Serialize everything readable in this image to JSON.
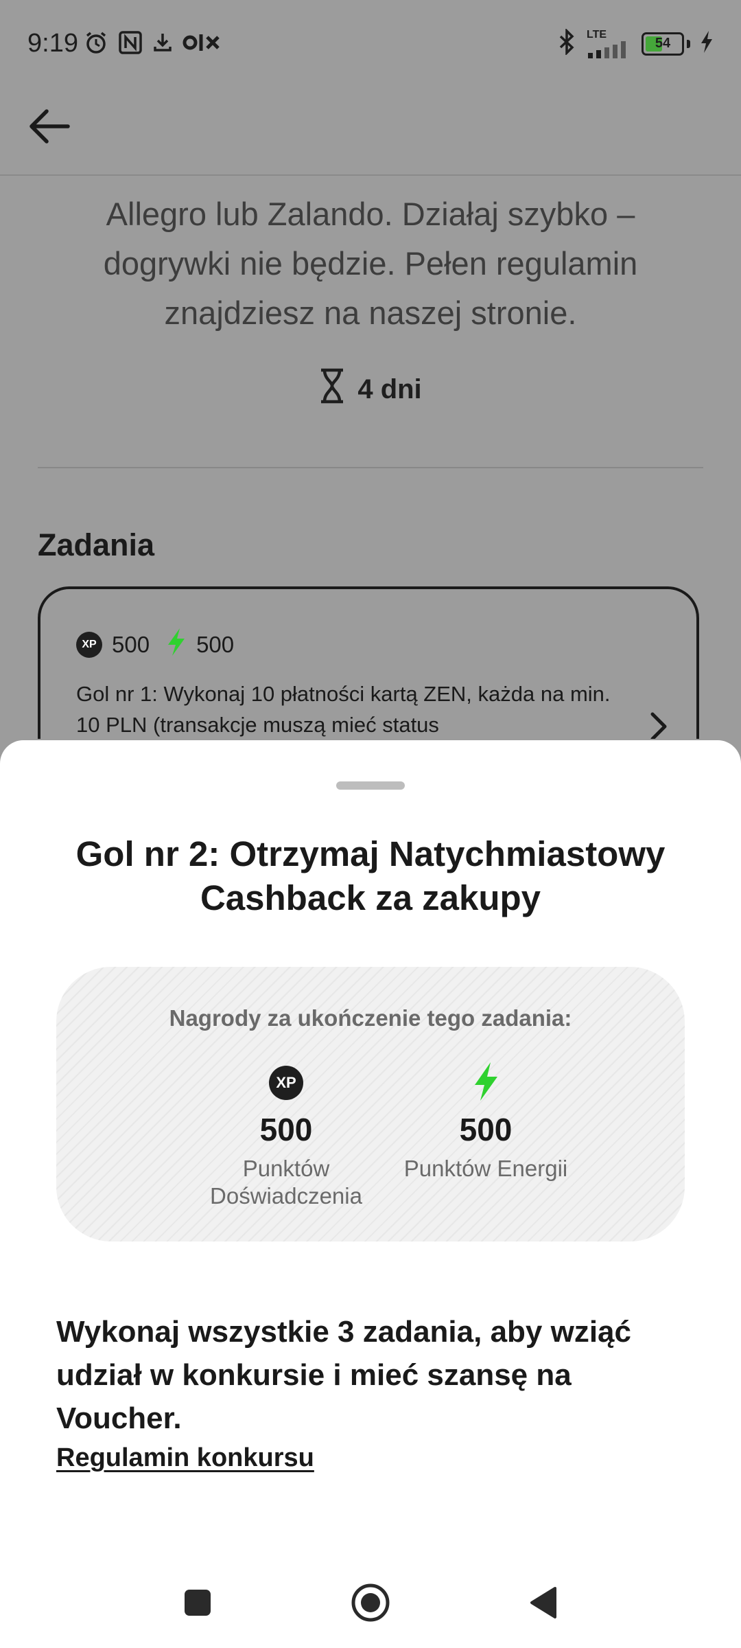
{
  "status_bar": {
    "time": "9:19",
    "network": "LTE",
    "battery": "54",
    "battery_level_percent": 54,
    "icons": [
      "alarm-icon",
      "nfc-icon",
      "download-icon",
      "olx-icon",
      "bluetooth-icon",
      "signal-icon",
      "battery-icon",
      "charging-icon"
    ]
  },
  "background_screen": {
    "description": "Allegro lub Zalando. Działaj szybko – dogrywki nie będzie. Pełen regulamin znajdziesz na naszej stronie.",
    "time_left": "4 dni",
    "section_title": "Zadania",
    "task_card": {
      "xp": "500",
      "xp_badge": "XP",
      "energy": "500",
      "title": "Gol nr 1: Wykonaj 10 płatności kartą ZEN, każda na min. 10 PLN (transakcje muszą mieć status"
    }
  },
  "sheet": {
    "title": "Gol nr 2: Otrzymaj Natychmiastowy Cashback za zakupy",
    "rewards_caption": "Nagrody za ukończenie tego zadania:",
    "rewards": {
      "xp": {
        "badge": "XP",
        "value": "500",
        "label": "Punktów Doświadczenia"
      },
      "energy": {
        "value": "500",
        "label": "Punktów Energii"
      }
    },
    "info": "Wykonaj wszystkie 3 zadania, aby wziąć udział w konkursie i mieć szansę na Voucher.",
    "rules_link": "Regulamin konkursu"
  },
  "colors": {
    "energy_green": "#2fd12f",
    "overlay_gray": "#9c9c9c",
    "text_dark": "#1a1a1a",
    "text_muted": "#6a6a6a"
  }
}
